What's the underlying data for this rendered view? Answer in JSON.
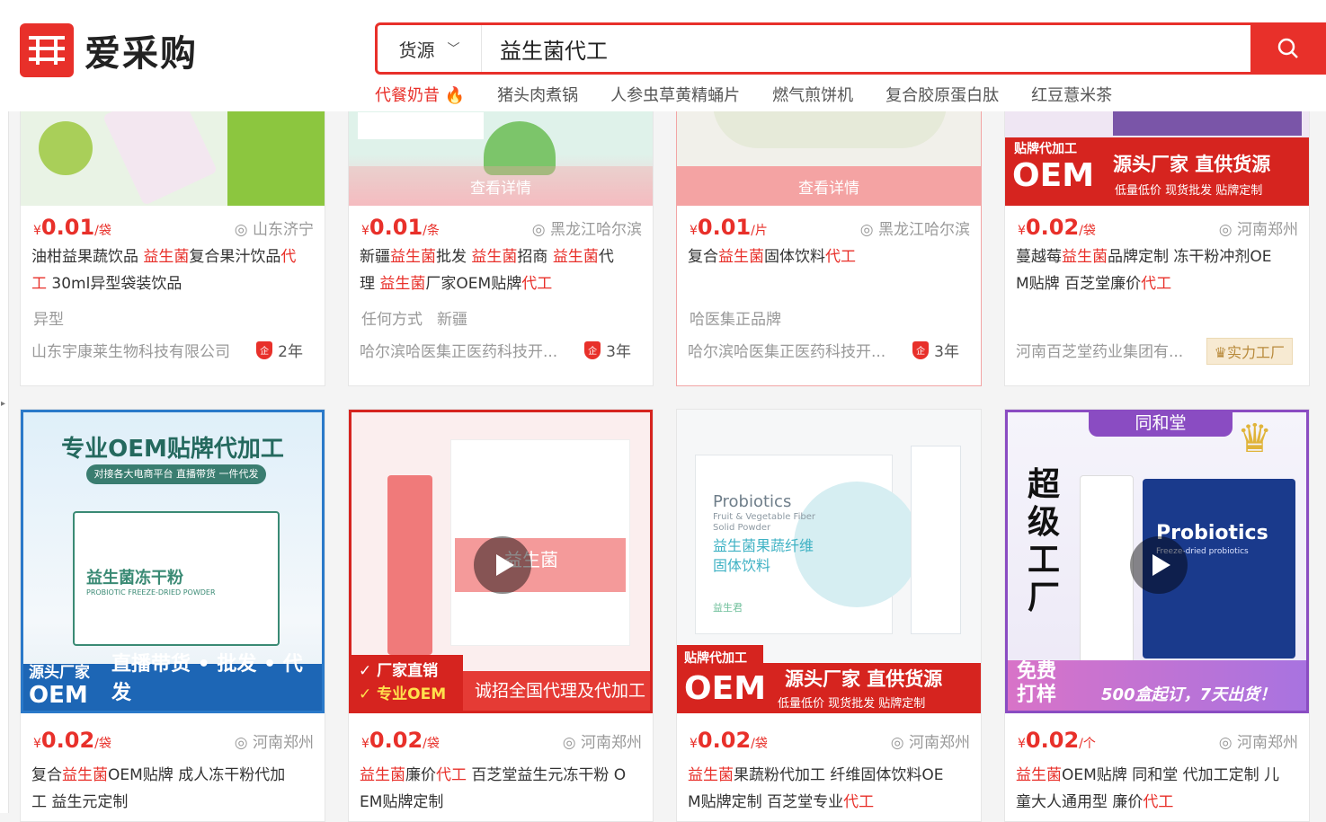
{
  "header": {
    "logo_text": "爱采购",
    "search_category": "货源",
    "search_query": "益生菌代工",
    "hot_searches": [
      "代餐奶昔",
      "猪头肉煮锅",
      "人参虫草黄精蛹片",
      "燃气煎饼机",
      "复合胶原蛋白肽",
      "红豆薏米茶"
    ]
  },
  "colors": {
    "brand": "#e8302a"
  },
  "row1": [
    {
      "price": "0.01",
      "unit": "/袋",
      "location": "山东济宁",
      "title": [
        [
          "油柑益果蔬饮品 ",
          0
        ],
        [
          "益生菌",
          1
        ],
        [
          "复合果汁饮品",
          0
        ],
        [
          "代",
          1
        ],
        [
          "\n",
          0
        ],
        [
          "工",
          1
        ],
        [
          " 30ml异型袋装饮品",
          0
        ]
      ],
      "tags": [
        "异型"
      ],
      "company": "山东宇康莱生物科技有限公司",
      "years": "2年"
    },
    {
      "price": "0.01",
      "unit": "/条",
      "location": "黑龙江哈尔滨",
      "title": [
        [
          "新疆",
          0
        ],
        [
          "益生菌",
          1
        ],
        [
          "批发 ",
          0
        ],
        [
          "益生菌",
          1
        ],
        [
          "招商 ",
          0
        ],
        [
          "益生菌",
          1
        ],
        [
          "代",
          0
        ],
        [
          "\n理 ",
          0
        ],
        [
          "益生菌",
          1
        ],
        [
          "厂家OEM贴牌",
          0
        ],
        [
          "代工",
          1
        ]
      ],
      "tags": [
        "任何方式",
        "新疆"
      ],
      "company": "哈尔滨哈医集正医药科技开...",
      "years": "3年",
      "overlay": "查看详情"
    },
    {
      "price": "0.01",
      "unit": "/片",
      "location": "黑龙江哈尔滨",
      "title": [
        [
          "复合",
          0
        ],
        [
          "益生菌",
          1
        ],
        [
          "固体饮料",
          0
        ],
        [
          "代工",
          1
        ]
      ],
      "tags": [
        "哈医集正品牌"
      ],
      "company": "哈尔滨哈医集正医药科技开...",
      "years": "3年",
      "overlay": "查看详情"
    },
    {
      "price": "0.02",
      "unit": "/袋",
      "location": "河南郑州",
      "title": [
        [
          "蔓越莓",
          0
        ],
        [
          "益生菌",
          1
        ],
        [
          "品牌定制 冻干粉冲剂OE\nM贴牌 百芝堂廉价",
          0
        ],
        [
          "代工",
          1
        ]
      ],
      "tags": [],
      "company": "河南百芝堂药业集团有...",
      "badge": "实力工厂",
      "image_text": {
        "top": "贴牌代加工",
        "oem": "OEM",
        "big": "源头厂家 直供货源",
        "small": "低量低价  现货批发  贴牌定制"
      }
    }
  ],
  "row2": [
    {
      "price": "0.02",
      "unit": "/袋",
      "location": "河南郑州",
      "title": [
        [
          "复合",
          0
        ],
        [
          "益生菌",
          1
        ],
        [
          "OEM贴牌 成人冻干粉代加\n工 益生元定制",
          0
        ]
      ],
      "image_text": {
        "head": "专业OEM贴牌代加工",
        "sub": "对接各大电商平台 直播带货 一件代发",
        "box": "益生菌冻干粉",
        "box_en": "PROBIOTIC FREEZE-DRIED POWDER",
        "corner1": "源头厂家",
        "corner2": "OEM",
        "banner": "直播带货 • 批发 • 代发"
      }
    },
    {
      "price": "0.02",
      "unit": "/袋",
      "location": "河南郑州",
      "title": [
        [
          "益生菌",
          1
        ],
        [
          "廉价",
          0
        ],
        [
          "代工",
          1
        ],
        [
          " 百芝堂益生元冻干粉 O\nEM贴牌定制",
          0
        ]
      ],
      "image_text": {
        "l1": "✓ 厂家直销",
        "l2": "✓ 专业OEM",
        "r": "诚招全国代理及代加工",
        "pack": "益生菌"
      }
    },
    {
      "price": "0.02",
      "unit": "/袋",
      "location": "河南郑州",
      "title": [
        [
          "益生菌",
          1
        ],
        [
          "果蔬粉代加工 纤维固体饮料OE\nM贴牌定制 百芝堂专业",
          0
        ],
        [
          "代工",
          1
        ]
      ],
      "image_text": {
        "p1": "Probiotics",
        "p2": "Fruit & Vegetable Fiber",
        "p3": "Solid Powder",
        "p4": "益生菌果蔬纤维",
        "p5": "固体饮料",
        "brand": "益生君",
        "top": "贴牌代加工",
        "oem": "OEM",
        "big": "源头厂家 直供货源",
        "small": "低量低价  现货批发  贴牌定制"
      }
    },
    {
      "price": "0.02",
      "unit": "/个",
      "location": "河南郑州",
      "title": [
        [
          "益生菌",
          1
        ],
        [
          "OEM贴牌 同和堂 代加工定制 儿\n童大人通用型 廉价",
          0
        ],
        [
          "代工",
          1
        ]
      ],
      "image_text": {
        "head": "同和堂",
        "v": "超级工厂",
        "free1": "免费",
        "free2": "打样",
        "bottom": "500盒起订，7天出货！",
        "box": "Probiotics",
        "box_sub": "Freeze-dried probiotics"
      }
    }
  ]
}
